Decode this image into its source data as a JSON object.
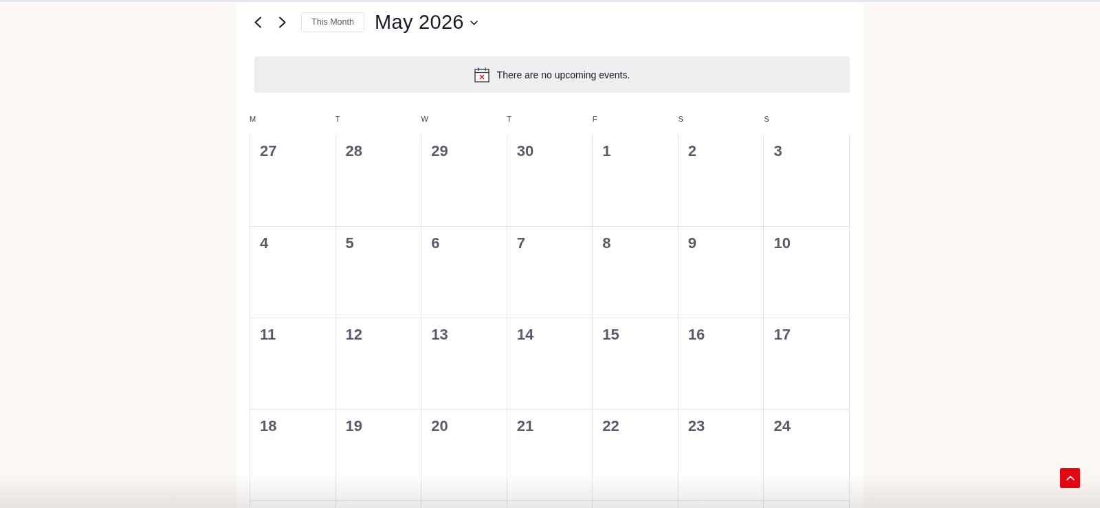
{
  "header": {
    "today_button": "This Month",
    "title": "May 2026"
  },
  "notice": {
    "text": "There are no upcoming events."
  },
  "weekdays": [
    "M",
    "T",
    "W",
    "T",
    "F",
    "S",
    "S"
  ],
  "weeks": [
    {
      "days": [
        "27",
        "28",
        "29",
        "30",
        "1",
        "2",
        "3"
      ]
    },
    {
      "days": [
        "4",
        "5",
        "6",
        "7",
        "8",
        "9",
        "10"
      ]
    },
    {
      "days": [
        "11",
        "12",
        "13",
        "14",
        "15",
        "16",
        "17"
      ]
    },
    {
      "days": [
        "18",
        "19",
        "20",
        "21",
        "22",
        "23",
        "24"
      ]
    }
  ]
}
